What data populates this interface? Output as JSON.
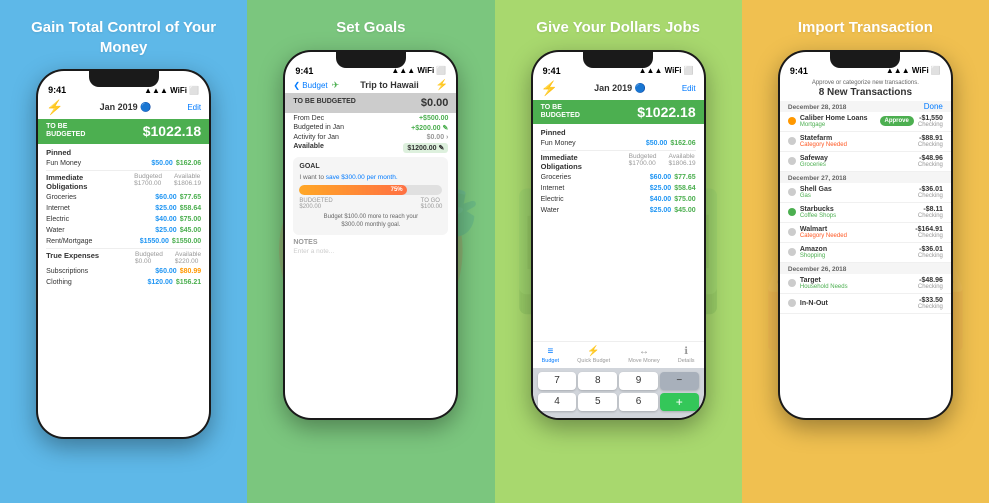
{
  "panels": [
    {
      "id": "panel-1",
      "bg": "panel-1",
      "title": "Gain Total Control of\nYour Money",
      "phone": {
        "time": "9:41",
        "month": "Jan 2019",
        "to_be_budgeted_label": "TO BE\nBUDGETED",
        "to_be_budgeted_amount": "$1022.18",
        "edit": "Edit",
        "sections": [
          {
            "label": "Pinned",
            "rows": [
              {
                "name": "Fun Money",
                "budgeted": "$50.00",
                "available": "$162.06"
              }
            ]
          },
          {
            "label": "Immediate\nObligations",
            "budgeted_header": "Budgeted\n$1700.00",
            "available_header": "Available\n$1806.19",
            "rows": [
              {
                "name": "Groceries",
                "budgeted": "$60.00",
                "available": "$77.65"
              },
              {
                "name": "Internet",
                "budgeted": "$25.00",
                "available": "$58.64"
              },
              {
                "name": "Electric",
                "budgeted": "$40.00",
                "available": "$75.00"
              },
              {
                "name": "Water",
                "budgeted": "$25.00",
                "available": "$45.00"
              },
              {
                "name": "Rent/Mortgage",
                "budgeted": "$1550.00",
                "available": "$1550.00"
              }
            ]
          },
          {
            "label": "True Expenses",
            "budgeted_header": "Budgeted\n$0.00",
            "available_header": "Available\n$220.00",
            "rows": [
              {
                "name": "Subscriptions",
                "budgeted": "$60.00",
                "available": "$80.99"
              },
              {
                "name": "Clothing",
                "budgeted": "$120.00",
                "available": "$156.21"
              }
            ]
          }
        ]
      }
    },
    {
      "id": "panel-2",
      "bg": "panel-2",
      "title": "Set Goals",
      "phone": {
        "time": "9:41",
        "back_label": "Budget",
        "trip_title": "Trip to Hawaii",
        "to_be_budgeted_label": "TO BE BUDGETED",
        "to_be_budgeted_amount": "$0.00",
        "from_dec": "+$500.00",
        "budgeted_in_jan": "+$200.00",
        "activity_for_jan": "$0.00",
        "available": "$1200.00",
        "goal_title": "GOAL",
        "goal_text": "I want to",
        "goal_link": "save $300.00 per month.",
        "goal_progress": 75,
        "goal_pct": "75%",
        "goal_budgeted": "BUDGETED\n$200.00",
        "goal_to_go": "TO GO\n$100.00",
        "goal_desc": "Budget $100.00 more to reach your\n$300.00 monthly goal.",
        "notes_label": "NOTES",
        "notes_placeholder": "Enter a note..."
      }
    },
    {
      "id": "panel-3",
      "bg": "panel-3",
      "title": "Give Your Dollars Jobs",
      "phone": {
        "time": "9:41",
        "month": "Jan 2019",
        "to_be_budgeted_label": "TO BE\nBUDGETED",
        "to_be_budgeted_amount": "$1022.18",
        "edit": "Edit",
        "sections": [
          {
            "label": "Pinned",
            "rows": [
              {
                "name": "Fun Money",
                "budgeted": "$50.00",
                "available": "$162.06"
              }
            ]
          },
          {
            "label": "Immediate\nObligations",
            "budgeted_header": "Budgeted\n$1700.00",
            "available_header": "Available\n$1806.19",
            "rows": [
              {
                "name": "Groceries",
                "budgeted": "$60.00",
                "available": "$77.65"
              },
              {
                "name": "Internet",
                "budgeted": "$25.00",
                "available": "$58.64"
              },
              {
                "name": "Electric",
                "budgeted": "$40.00",
                "available": "$75.00"
              },
              {
                "name": "Water",
                "budgeted": "$25.00",
                "available": "$45.00"
              }
            ]
          }
        ],
        "tabs": [
          "Budget",
          "Quick Budget",
          "Move Money",
          "Details"
        ]
      }
    },
    {
      "id": "panel-4",
      "bg": "panel-4",
      "title": "Import Transaction",
      "phone": {
        "time": "9:41",
        "approve_text": "Approve or categorize new transactions.",
        "new_transactions_count": "8 New Transactions",
        "done_label": "Done",
        "dates": [
          {
            "date": "December 28, 2018",
            "transactions": [
              {
                "dot": "#FF9800",
                "name": "Caliber Home Loans",
                "category": "Mortgage",
                "amount": "-$1,550",
                "account": "Checking",
                "has_approve": true
              },
              {
                "dot": "#9E9E9E",
                "name": "Statefarm",
                "category": "Category Needed",
                "category_style": "needed",
                "amount": "-$88.91",
                "account": "Checking"
              },
              {
                "dot": "#9E9E9E",
                "name": "Safeway",
                "category": "Groceries",
                "amount": "-$48.96",
                "account": "Checking"
              }
            ]
          },
          {
            "date": "December 27, 2018",
            "transactions": [
              {
                "dot": "#9E9E9E",
                "name": "Shell Gas",
                "category": "Gas",
                "amount": "-$36.01",
                "account": "Checking"
              },
              {
                "dot": "#4CAF50",
                "name": "Starbucks",
                "category": "Coffee Shops",
                "amount": "-$8.11",
                "account": "Checking"
              },
              {
                "dot": "#9E9E9E",
                "name": "Walmart",
                "category": "Category Needed",
                "category_style": "needed",
                "amount": "-$164.91",
                "account": "Checking"
              },
              {
                "dot": "#9E9E9E",
                "name": "Amazon",
                "category": "Shopping",
                "amount": "-$36.01",
                "account": "Checking"
              }
            ]
          },
          {
            "date": "December 26, 2018",
            "transactions": [
              {
                "dot": "#9E9E9E",
                "name": "Target",
                "category": "Household Needs",
                "amount": "-$48.96",
                "account": "Checking"
              },
              {
                "dot": "#9E9E9E",
                "name": "In-N-Out",
                "category": "",
                "amount": "-$33.50",
                "account": "Checking"
              }
            ]
          }
        ]
      }
    }
  ]
}
